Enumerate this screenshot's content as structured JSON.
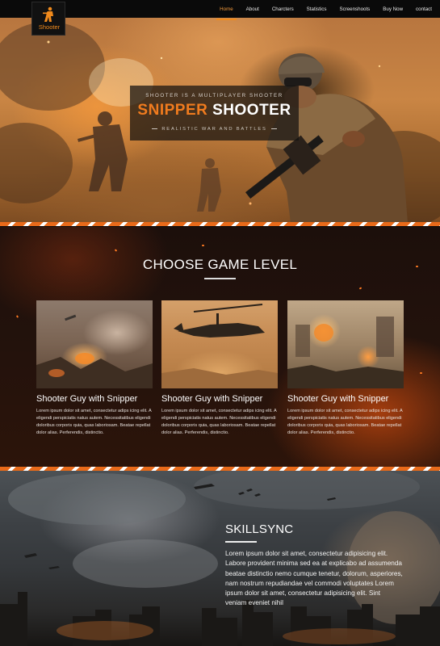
{
  "logo": {
    "text": "Shooter",
    "icon": "soldier-icon"
  },
  "nav": {
    "items": [
      {
        "label": "Home",
        "active": true
      },
      {
        "label": "About",
        "active": false
      },
      {
        "label": "Charcters",
        "active": false
      },
      {
        "label": "Statistics",
        "active": false
      },
      {
        "label": "Screenshoots",
        "active": false
      },
      {
        "label": "Buy Now",
        "active": false
      },
      {
        "label": "contact",
        "active": false
      }
    ]
  },
  "hero": {
    "kicker": "SHOOTER IS A MULTIPLAYER SHOOTER",
    "title_part1": "SNIPPER",
    "title_part2": "SHOOTER",
    "subtitle": "REALISTIC WAR AND BATTLES"
  },
  "levels": {
    "title": "CHOOSE GAME LEVEL",
    "cards": [
      {
        "title": "Shooter Guy with Snipper",
        "text": "Lorem ipsum dolor sit amet, consectetur adips icing elit. A eligendi perspiciatis natus autem. Necessitatibus eligendi doloribus corporis quia, quas laboriosam. Beatae repellat dolor alias. Perferendis, distinctio."
      },
      {
        "title": "Shooter Guy with Snipper",
        "text": "Lorem ipsum dolor sit amet, consectetur adips icing elit. A eligendi perspiciatis natus autem. Necessitatibus eligendi doloribus corporis quia, quas laboriosam. Beatae repellat dolor alias. Perferendis, distinctio."
      },
      {
        "title": "Shooter Guy with Snipper",
        "text": "Lorem ipsum dolor sit amet, consectetur adips icing elit. A eligendi perspiciatis natus autem. Necessitatibus eligendi doloribus corporis quia, quas laboriosam. Beatae repellat dolor alias. Perferendis, distinctio."
      }
    ]
  },
  "skill": {
    "title": "SKILLSYNC",
    "text": "Lorem ipsum dolor sit amet, consectetur adipisicing elit. Labore provident minima sed ea at explicabo ad assumenda beatae distinctio nemo cumque tenetur, dolorum, asperiores, nam nostrum repudiandae vel commodi voluptates Lorem ipsum dolor sit amet, consectetur adipisicing elit. Sint veniam eveniet nihil"
  },
  "colors": {
    "accent": "#f07b1e",
    "nav_bg": "#0a0a0a",
    "stripe_white": "#ffffff"
  }
}
